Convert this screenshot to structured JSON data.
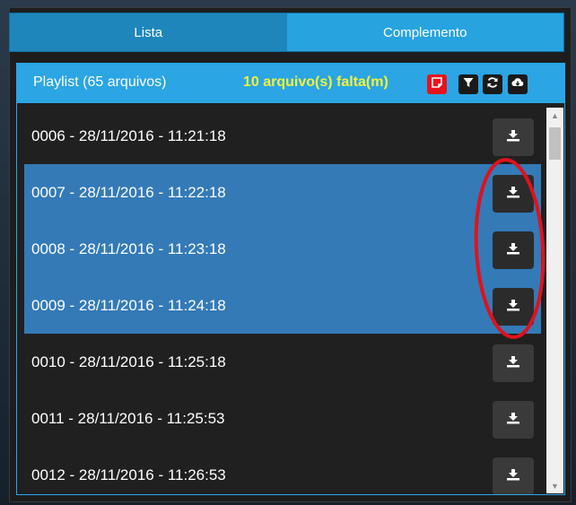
{
  "tabs": [
    {
      "label": "Lista",
      "active": true
    },
    {
      "label": "Complemento",
      "active": false
    }
  ],
  "playlist": {
    "title": "Playlist (65 arquivos)",
    "missing": "10 arquivo(s) falta(m)",
    "header_buttons": [
      {
        "name": "note-icon",
        "color": "#e8131c"
      },
      {
        "name": "filter-icon"
      },
      {
        "name": "refresh-icon"
      },
      {
        "name": "cloud-download-icon"
      }
    ],
    "rows": [
      {
        "label": "0006 - 28/11/2016 - 11:21:18",
        "selected": false
      },
      {
        "label": "0007 - 28/11/2016 - 11:22:18",
        "selected": true
      },
      {
        "label": "0008 - 28/11/2016 - 11:23:18",
        "selected": true
      },
      {
        "label": "0009 - 28/11/2016 - 11:24:18",
        "selected": true
      },
      {
        "label": "0010 - 28/11/2016 - 11:25:18",
        "selected": false
      },
      {
        "label": "0011 - 28/11/2016 - 11:25:53",
        "selected": false
      },
      {
        "label": "0012 - 28/11/2016 - 11:26:53",
        "selected": false
      }
    ]
  },
  "colors": {
    "accent": "#2ba5e4",
    "selected_row": "#337ab7",
    "missing_text": "#f2f23a",
    "annotation": "#e0121c"
  }
}
